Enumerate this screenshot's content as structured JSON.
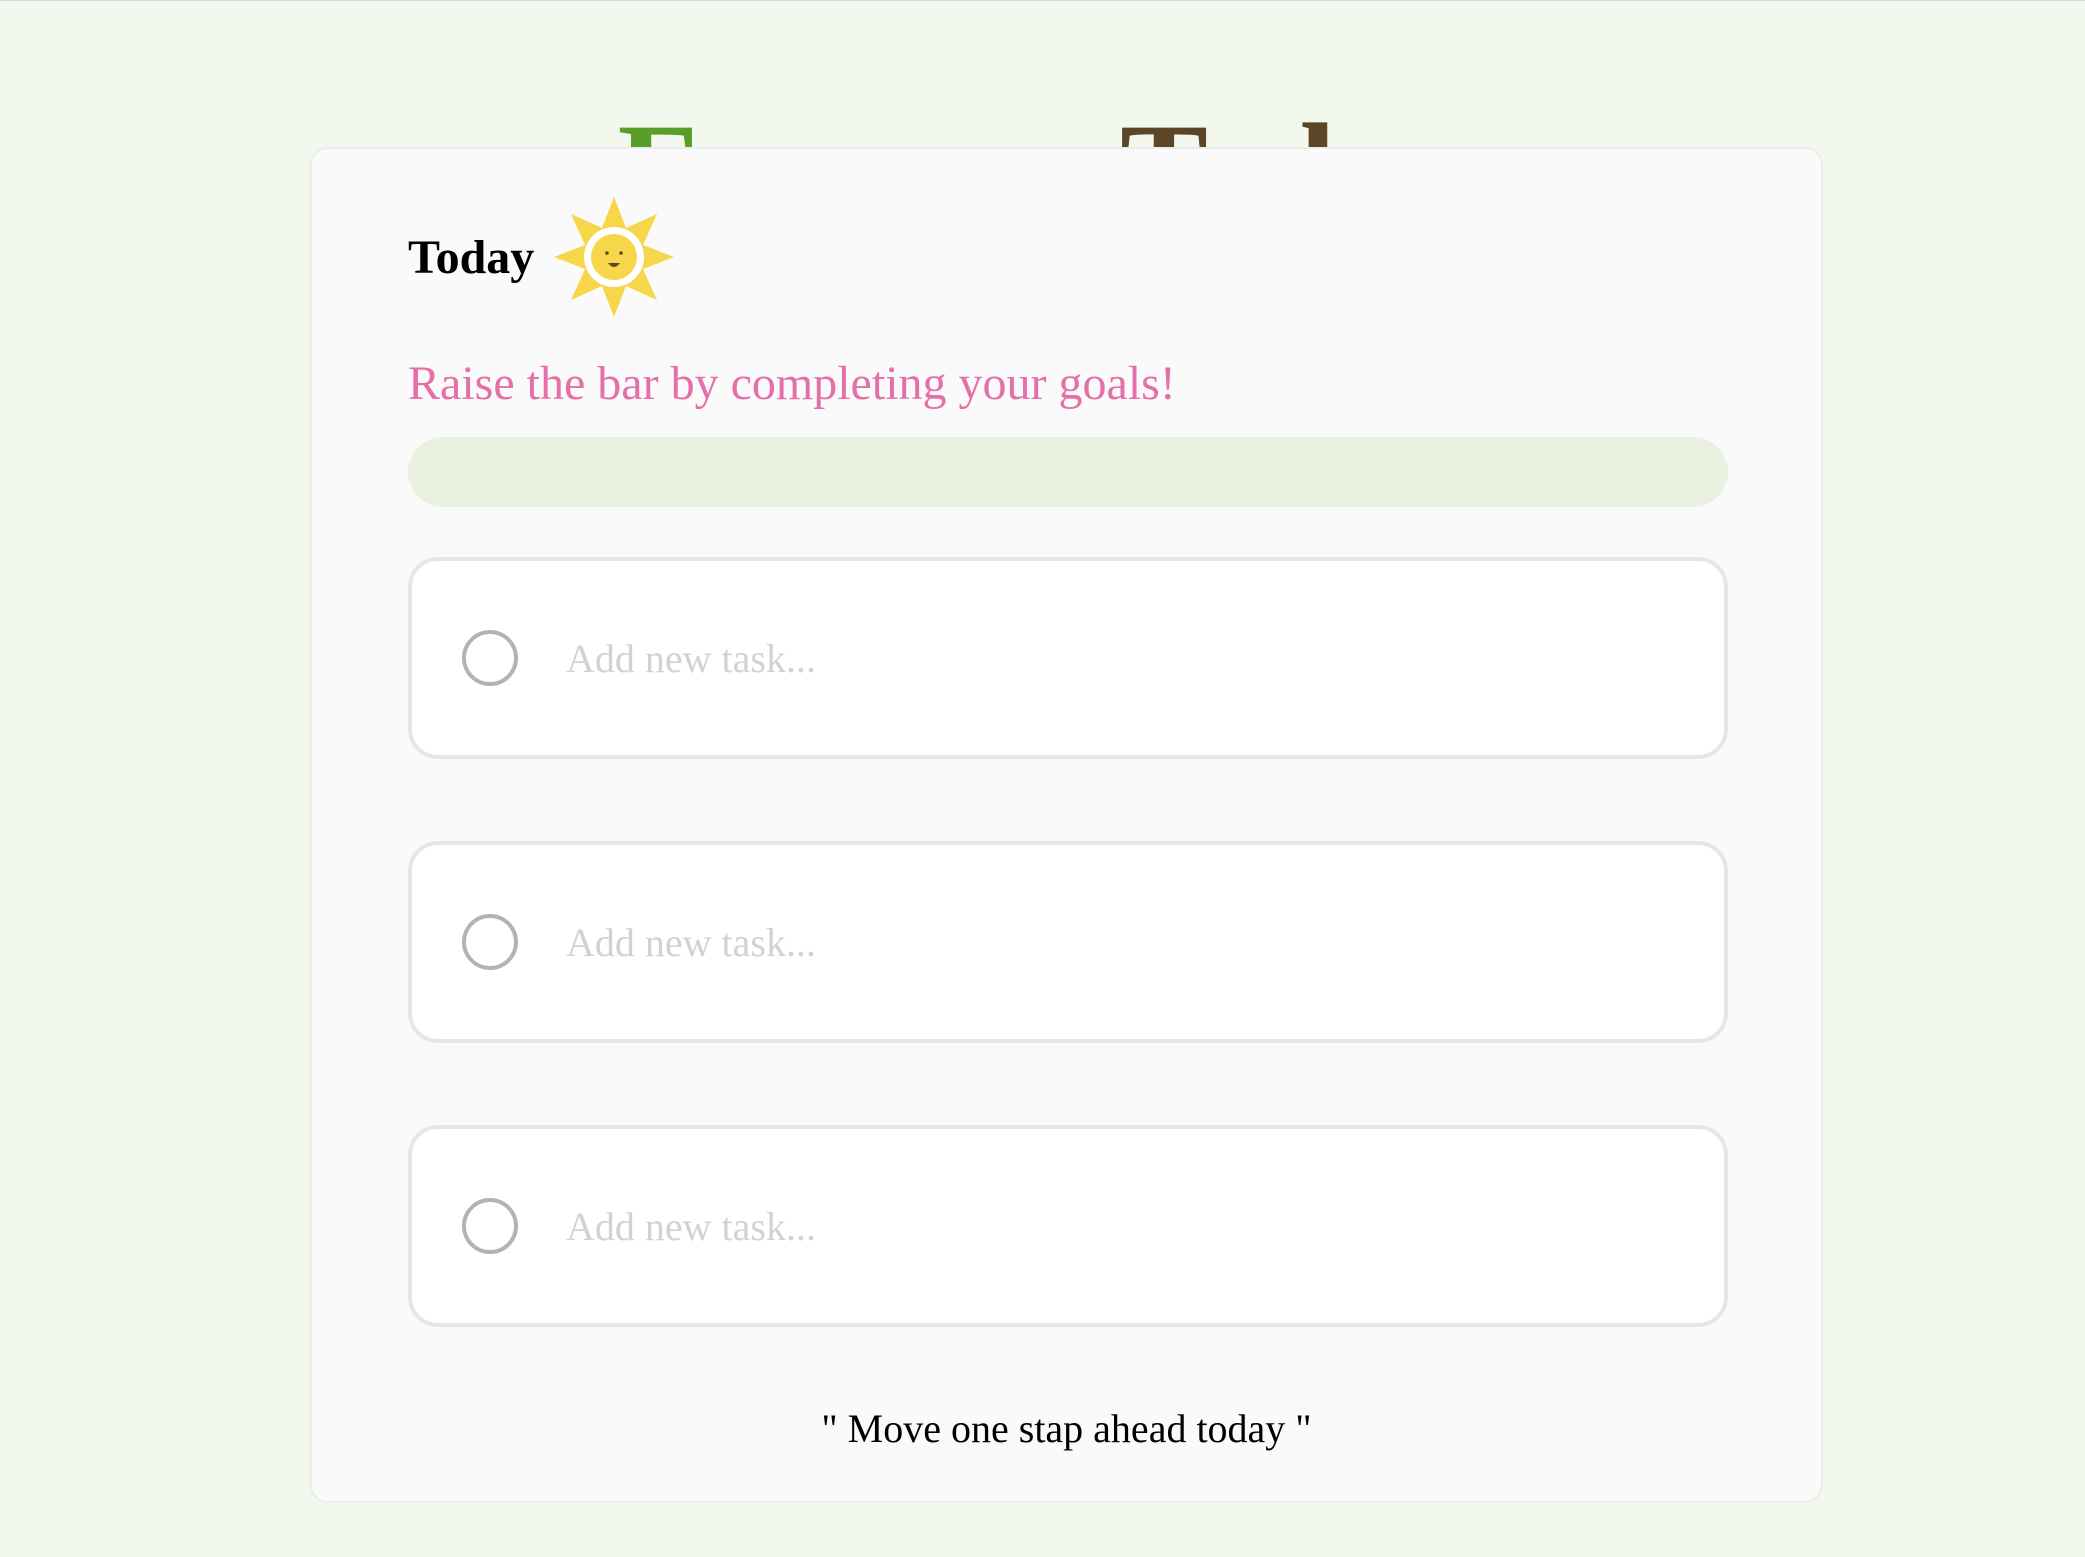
{
  "header": {
    "title_part1": "Focus on",
    "title_part2": "Today"
  },
  "card": {
    "heading": "Today",
    "heading_icon": "smiling-sun-icon",
    "subtitle": "Raise the bar by completing your goals!",
    "progress": {
      "completed": 0,
      "total": 3,
      "fraction": 0
    },
    "tasks": [
      {
        "placeholder": "Add new task...",
        "value": "",
        "completed": false
      },
      {
        "placeholder": "Add new task...",
        "value": "",
        "completed": false
      },
      {
        "placeholder": "Add new task...",
        "value": "",
        "completed": false
      }
    ],
    "quote": "\" Move one stap ahead today \""
  },
  "colors": {
    "page_background": "#f3f8ee",
    "title_green": "#5a9e2a",
    "title_brown": "#5c4626",
    "subtitle_pink": "#e56fa8",
    "progress_track": "#eaf1e1",
    "progress_fill": "#5a9e2a",
    "sun_yellow": "#f7d64a"
  }
}
